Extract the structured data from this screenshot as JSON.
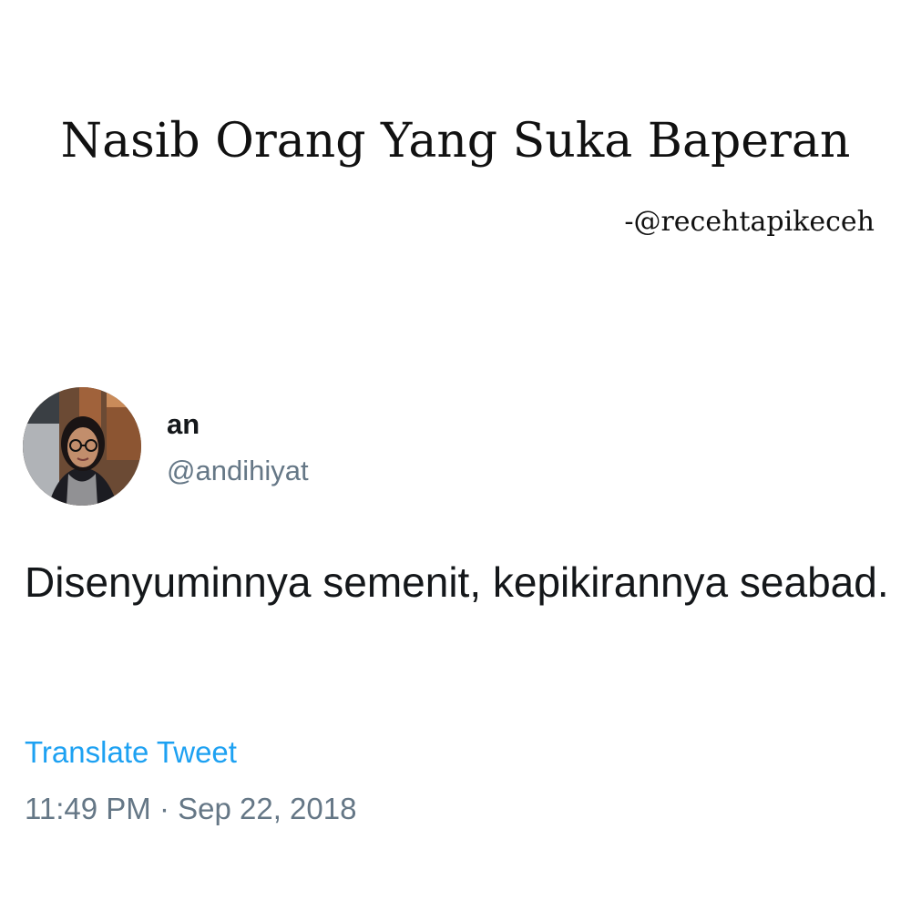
{
  "header": {
    "title": "Nasib Orang Yang Suka Baperan",
    "credit": "-@recehtapikeceh"
  },
  "tweet": {
    "avatar_icon": "profile-photo",
    "display_name": "an",
    "handle": "@andihiyat",
    "text": "Disenyuminnya semenit, kepikirannya seabad.",
    "translate_label": "Translate Tweet",
    "timestamp": "11:49 PM · Sep 22, 2018"
  },
  "colors": {
    "link": "#1da1f2",
    "secondary_text": "#657786",
    "primary_text": "#14171a"
  }
}
